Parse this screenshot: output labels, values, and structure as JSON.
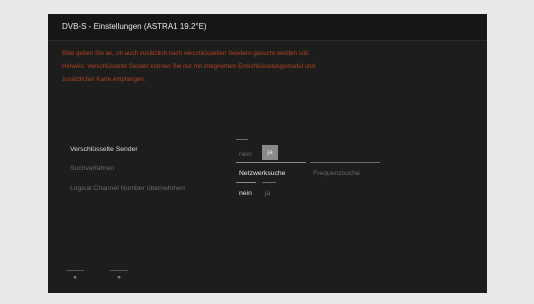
{
  "screen": {
    "title": "DVB-S - Einstellungen (ASTRA1 19.2°E)",
    "description_lines": [
      "Bitte geben Sie an, ob auch zusätzlich nach verschlüsselten Sendern gesucht werden soll.",
      "Hinweis: Verschlüsselte Sender können Sie nur mit integriertem Entschlüsselungsmodul und",
      "zusätzlicher Karte empfangen."
    ]
  },
  "settings": {
    "encrypted": {
      "label": "Verschlüsselte Sender",
      "options": [
        "nein",
        "ja"
      ],
      "selected": "ja"
    },
    "search_method": {
      "label": "Suchverfahren",
      "options": [
        "Netzwerksuche",
        "Frequenzsuche"
      ],
      "selected": "Netzwerksuche"
    },
    "lcn": {
      "label": "Logical Channel Number übernehmen",
      "options": [
        "nein",
        "ja"
      ],
      "selected": "nein"
    }
  },
  "nav": {
    "back_label": "«",
    "forward_label": "»"
  }
}
